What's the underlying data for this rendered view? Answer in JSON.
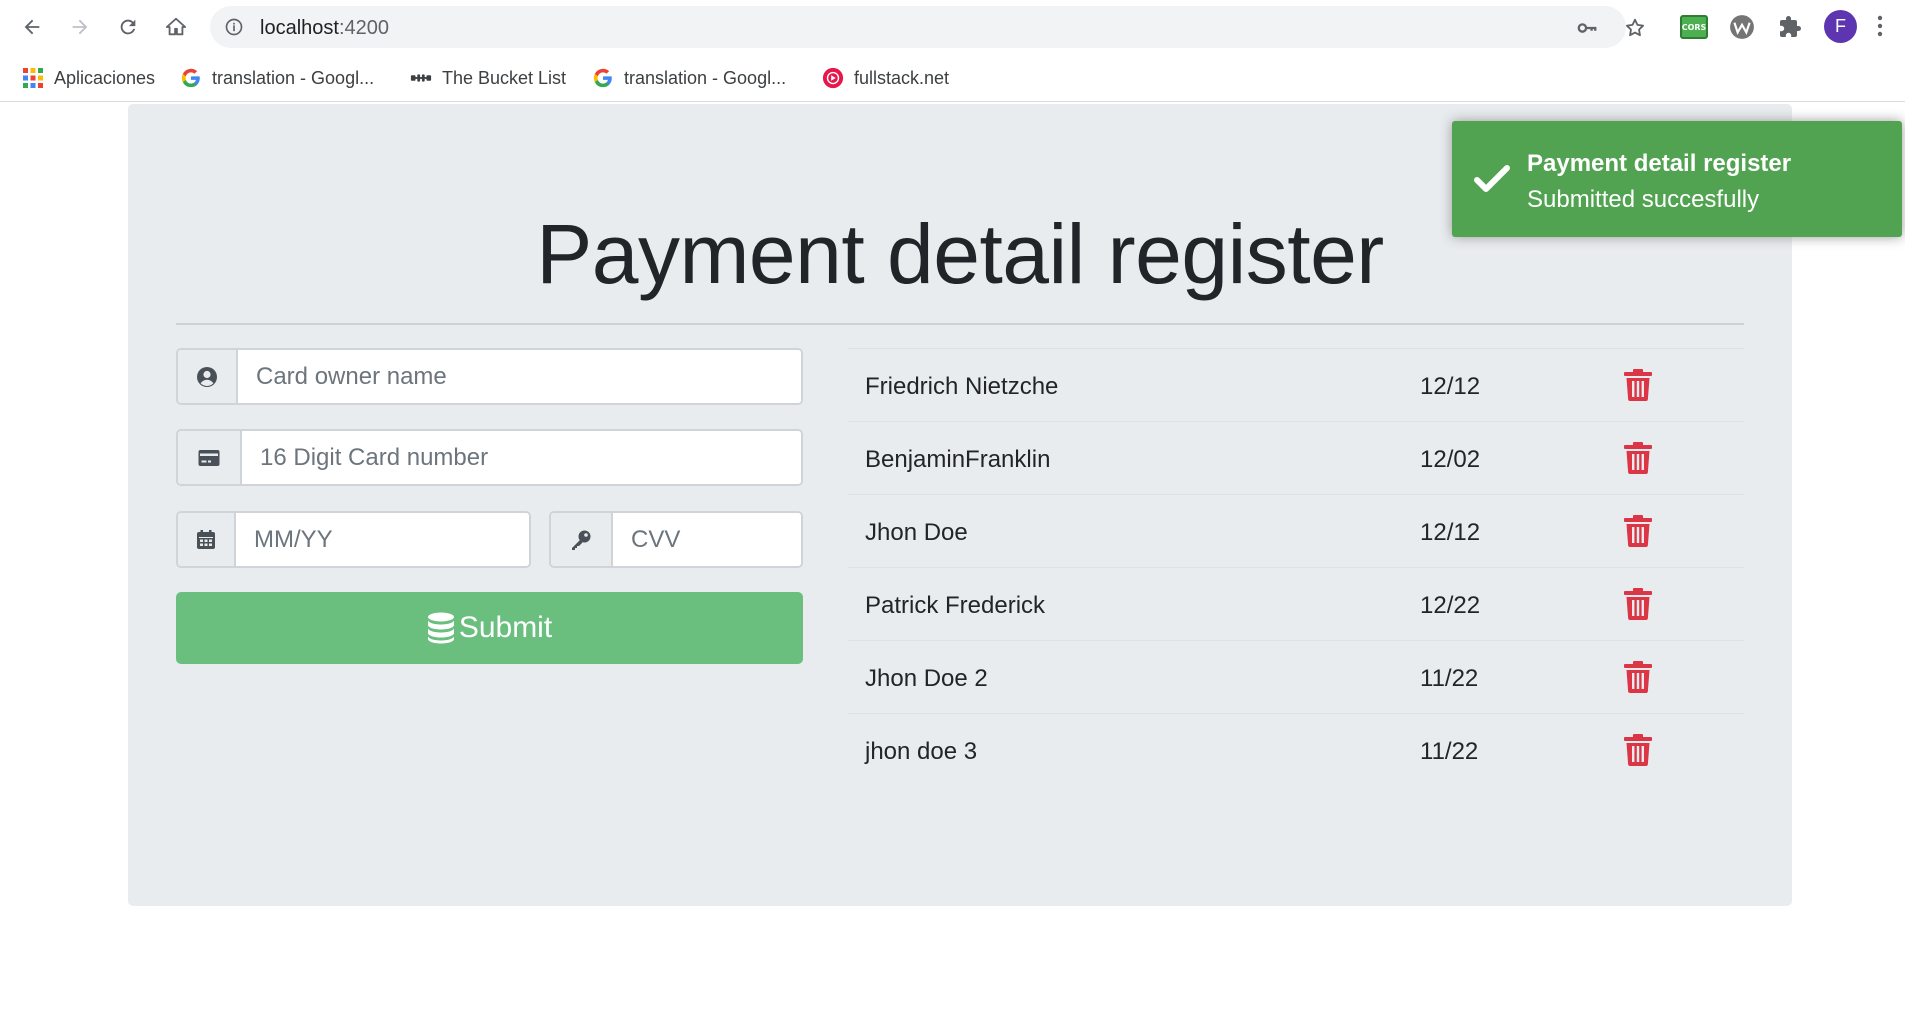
{
  "browser": {
    "url_host": "localhost",
    "url_port": ":4200",
    "avatar_letter": "F",
    "cors_label": "CORS",
    "bookmarks": [
      {
        "label": "Aplicaciones",
        "icon": "apps-grid-icon"
      },
      {
        "label": "translation - Googl...",
        "icon": "google-icon"
      },
      {
        "label": "The Bucket List",
        "icon": "bucket-list-icon"
      },
      {
        "label": "translation - Googl...",
        "icon": "google-icon"
      },
      {
        "label": "fullstack.net",
        "icon": "fullstack-icon"
      }
    ]
  },
  "page": {
    "title": "Payment detail register",
    "form": {
      "owner_placeholder": "Card owner name",
      "card_placeholder": "16 Digit Card number",
      "exp_placeholder": "MM/YY",
      "cvv_placeholder": "CVV",
      "submit_label": "Submit"
    },
    "payments": [
      {
        "name": "Friedrich Nietzche",
        "expiry": "12/12"
      },
      {
        "name": "BenjaminFranklin",
        "expiry": "12/02"
      },
      {
        "name": "Jhon Doe",
        "expiry": "12/12"
      },
      {
        "name": "Patrick Frederick",
        "expiry": "12/22"
      },
      {
        "name": "Jhon Doe 2",
        "expiry": "11/22"
      },
      {
        "name": "jhon doe 3",
        "expiry": "11/22"
      }
    ]
  },
  "toast": {
    "title": "Payment detail register",
    "message": "Submitted succesfully"
  },
  "colors": {
    "jumbotron_bg": "#e9ecef",
    "submit_bg": "#6abf7e",
    "toast_bg": "#51a351",
    "danger": "#dc3545"
  }
}
